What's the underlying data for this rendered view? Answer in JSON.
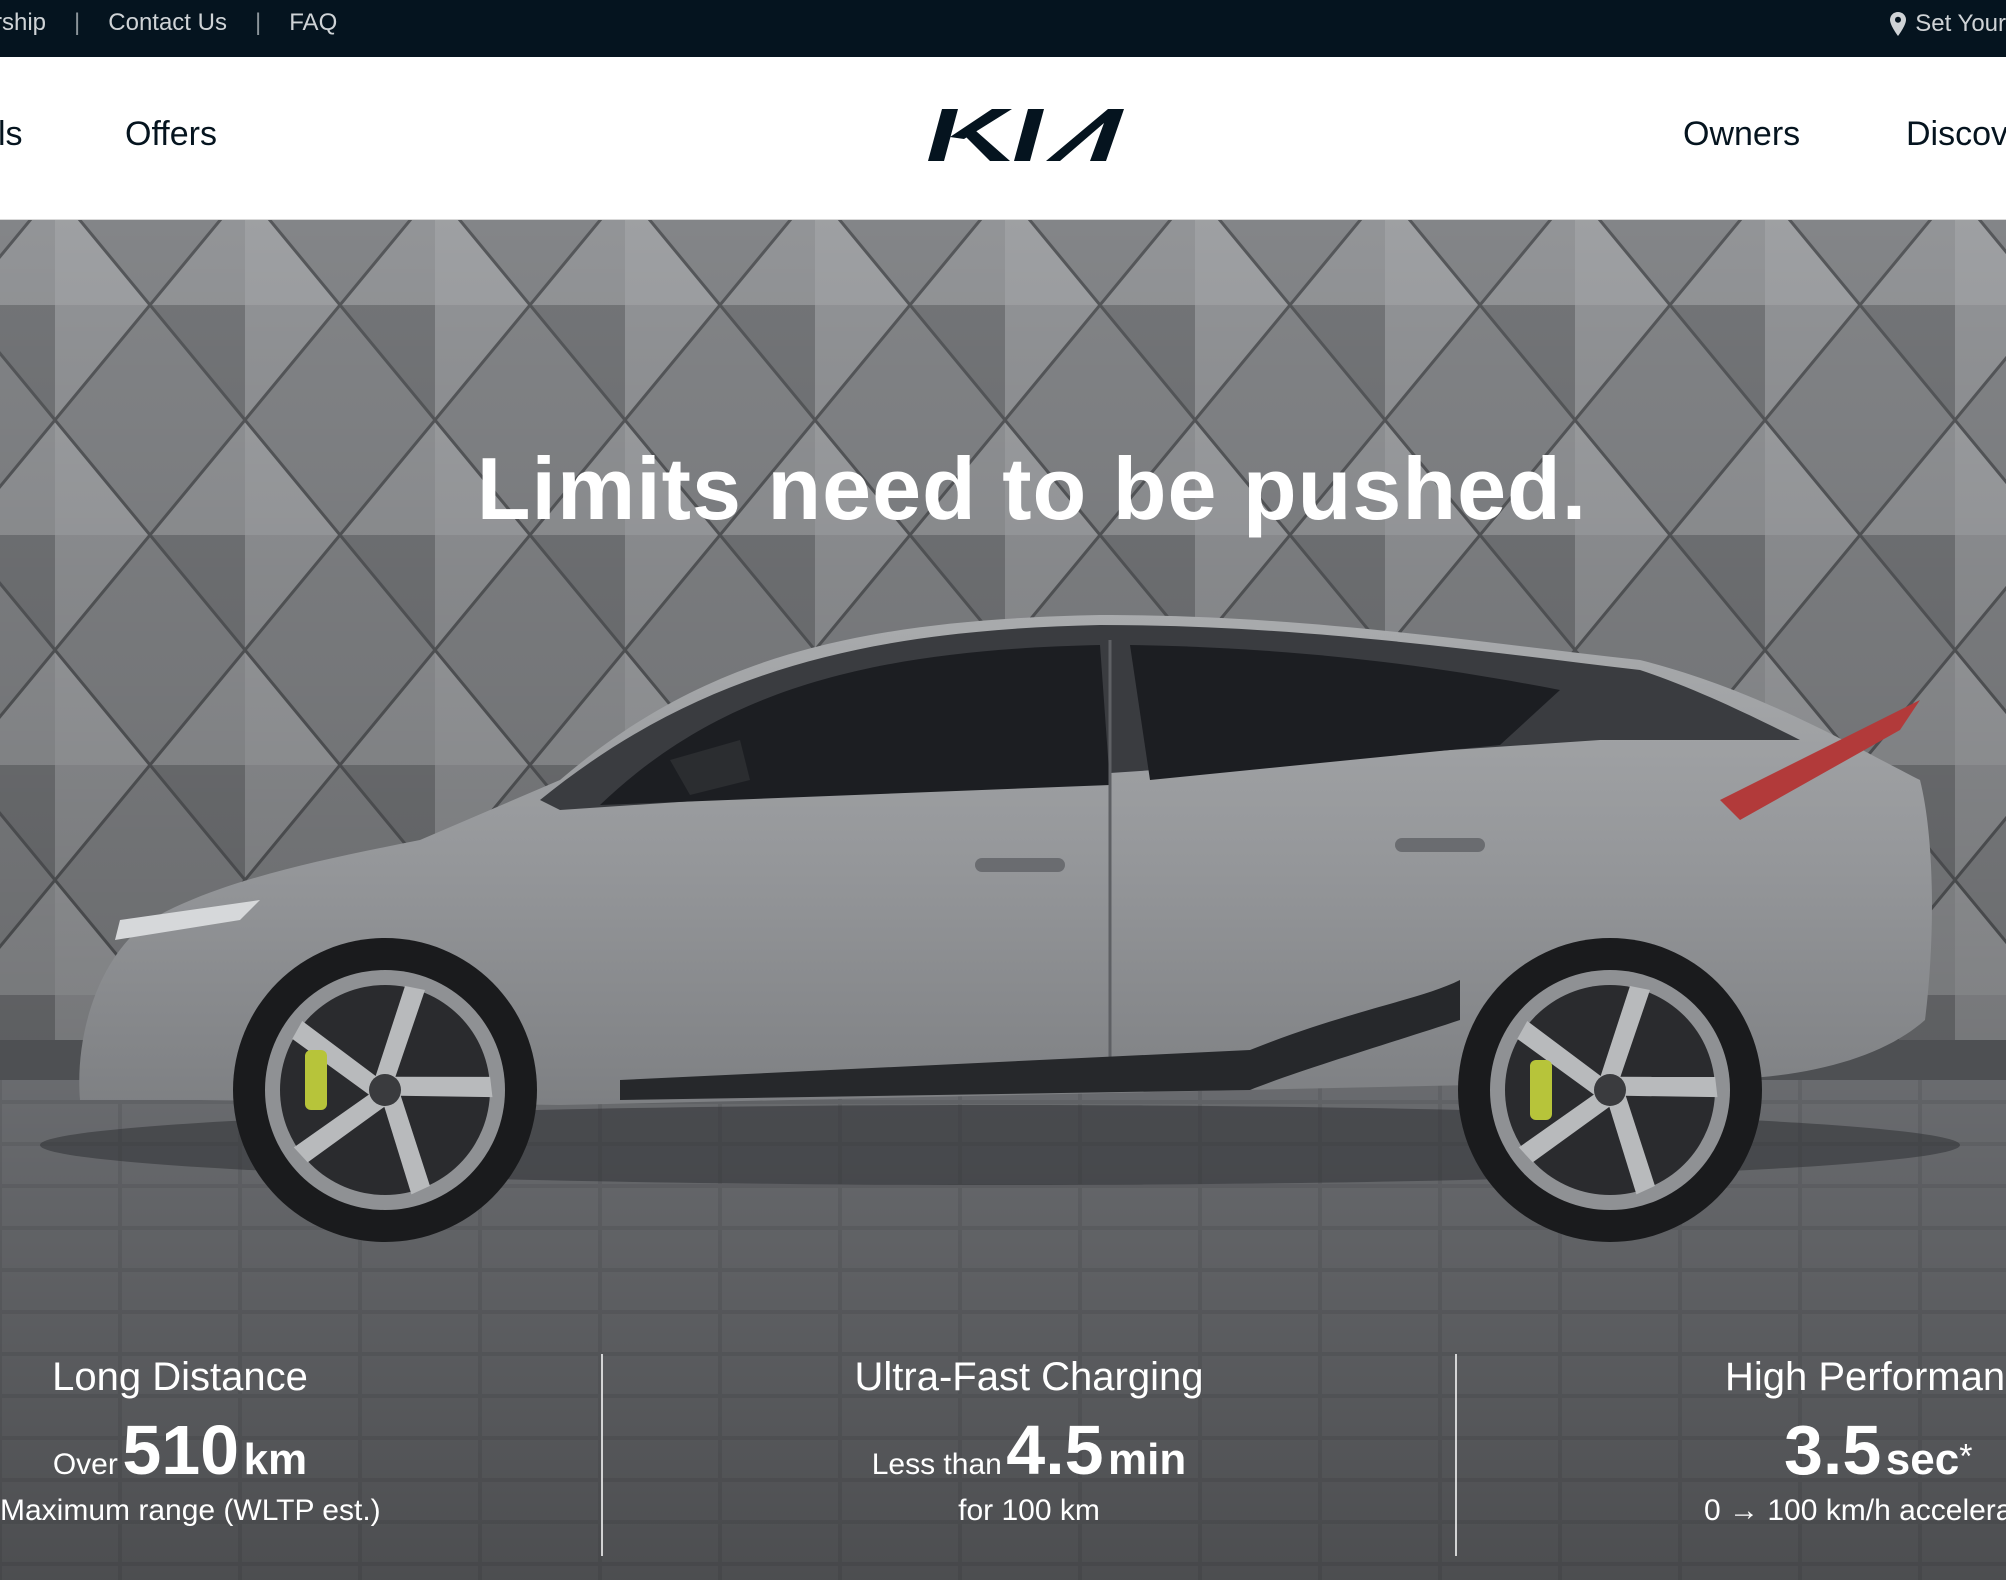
{
  "utility_bar": {
    "links": [
      "rship",
      "Contact Us",
      "FAQ"
    ],
    "location_label": "Set Your"
  },
  "nav": {
    "left_items": [
      "ls",
      "Offers"
    ],
    "right_items": [
      "Owners",
      "Discov"
    ],
    "logo_alt": "KIA"
  },
  "hero": {
    "headline": "Limits need to be pushed."
  },
  "stats": [
    {
      "label": "Long Distance",
      "prefix": "Over",
      "value": "510",
      "unit": "km",
      "note": "Maximum range (WLTP est.)"
    },
    {
      "label": "Ultra-Fast Charging",
      "prefix": "Less than",
      "value": "4.5",
      "unit": "min",
      "note": "for 100 km"
    },
    {
      "label": "High Performanc",
      "prefix": "",
      "value": "3.5",
      "unit": "sec",
      "mark": "*",
      "note": "0 → 100 km/h accelera"
    }
  ],
  "colors": {
    "topbar": "#05141f",
    "brand": "#05141f",
    "hero_text": "#ffffff"
  }
}
